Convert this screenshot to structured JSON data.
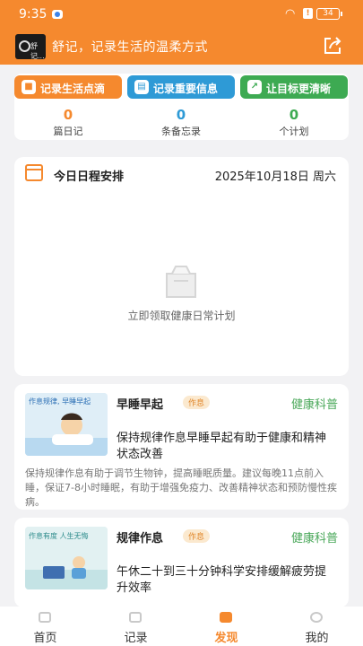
{
  "status": {
    "time": "9:35",
    "battery": "34"
  },
  "app": {
    "title": "舒记，记录生活的温柔方式",
    "logo_text": "舒记..."
  },
  "stats": [
    {
      "label": "记录生活点滴",
      "count": "0",
      "unit": "篇日记",
      "color": "#f5892e",
      "icon": "diary-icon"
    },
    {
      "label": "记录重要信息",
      "count": "0",
      "unit": "条备忘录",
      "color": "#2e9ad6",
      "icon": "clipboard-icon"
    },
    {
      "label": "让目标更清晰",
      "count": "0",
      "unit": "个计划",
      "color": "#3daa52",
      "icon": "chart-up-icon"
    }
  ],
  "schedule": {
    "title": "今日日程安排",
    "date": "2025年10月18日 周六",
    "empty_text": "立即领取健康日常计划"
  },
  "articles": [
    {
      "title": "早睡早起",
      "tag": "作息",
      "category": "健康科普",
      "headline": "保持规律作息早睡早起有助于健康和精神状态改善",
      "desc": "保持规律作息有助于调节生物钟，提高睡眠质量。建议每晚11点前入睡，保证7-8小时睡眠，有助于增强免疫力、改善精神状态和预防慢性疾病。",
      "image_text": "作息规律, 早睡早起"
    },
    {
      "title": "规律作息",
      "tag": "作息",
      "category": "健康科普",
      "headline": "午休二十到三十分钟科学安排缓解疲劳提升效率",
      "image_text": "作息有度 人生无悔"
    }
  ],
  "tabs": [
    {
      "label": "首页",
      "icon": "home-icon"
    },
    {
      "label": "记录",
      "icon": "record-icon"
    },
    {
      "label": "发现",
      "icon": "discover-icon",
      "active": true
    },
    {
      "label": "我的",
      "icon": "profile-icon"
    }
  ],
  "colors": {
    "brand": "#f5892e",
    "green": "#4aa85a",
    "blue": "#2e9ad6"
  }
}
